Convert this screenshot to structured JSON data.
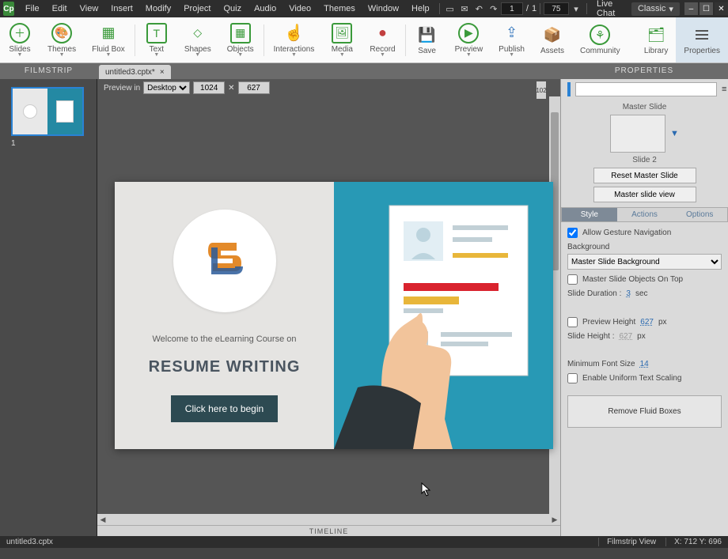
{
  "menubar": {
    "items": [
      "File",
      "Edit",
      "View",
      "Insert",
      "Modify",
      "Project",
      "Quiz",
      "Audio",
      "Video",
      "Themes",
      "Window",
      "Help"
    ],
    "page_current": "1",
    "page_total": "1",
    "zoom": "75",
    "live_chat": "Live Chat",
    "workspace": "Classic"
  },
  "ribbon": {
    "items": [
      {
        "label": "Slides",
        "icon": "＋"
      },
      {
        "label": "Themes",
        "icon": "🎨"
      },
      {
        "label": "Fluid Box",
        "icon": "▦"
      },
      {
        "label": "Text",
        "icon": "T"
      },
      {
        "label": "Shapes",
        "icon": "◇"
      },
      {
        "label": "Objects",
        "icon": "▦"
      },
      {
        "label": "Interactions",
        "icon": "☝"
      },
      {
        "label": "Media",
        "icon": "🖼"
      },
      {
        "label": "Record",
        "icon": "●"
      },
      {
        "label": "Save",
        "icon": "💾"
      },
      {
        "label": "Preview",
        "icon": "▶"
      },
      {
        "label": "Publish",
        "icon": "⇪"
      },
      {
        "label": "Assets",
        "icon": "📦"
      },
      {
        "label": "Community",
        "icon": "⚘"
      },
      {
        "label": "Library",
        "icon": "🗂"
      },
      {
        "label": "Properties",
        "icon": "≡"
      }
    ]
  },
  "tabrow": {
    "filmstrip_label": "FILMSTRIP",
    "file_tab": "untitled3.cptx*",
    "properties_label": "PROPERTIES"
  },
  "canvas": {
    "preview_in_label": "Preview in",
    "preview_device": "Desktop",
    "width": "1024",
    "height": "627",
    "link_symbol": "✕",
    "ruler_val": "102",
    "timeline_label": "TIMELINE"
  },
  "filmstrip": {
    "slide_number": "1"
  },
  "slide": {
    "welcome": "Welcome to the eLearning Course on",
    "title": "RESUME WRITING",
    "button": "Click here to begin"
  },
  "props": {
    "master_slide_label": "Master Slide",
    "slide_name": "Slide 2",
    "reset_master": "Reset Master Slide",
    "master_view": "Master slide view",
    "tabs": [
      "Style",
      "Actions",
      "Options"
    ],
    "allow_gesture": "Allow Gesture Navigation",
    "background_label": "Background",
    "background_value": "Master Slide Background",
    "master_objects_top": "Master Slide Objects On Top",
    "slide_duration_label": "Slide Duration :",
    "slide_duration_val": "3",
    "slide_duration_unit": "sec",
    "preview_height_label": "Preview Height",
    "preview_height_val": "627",
    "px": "px",
    "slide_height_label": "Slide Height :",
    "slide_height_val": "627",
    "min_font_label": "Minimum Font Size",
    "min_font_val": "14",
    "uniform_scaling": "Enable Uniform Text Scaling",
    "remove_fluid": "Remove Fluid Boxes"
  },
  "statusbar": {
    "file": "untitled3.cptx",
    "view": "Filmstrip View",
    "coords": "X: 712 Y: 696"
  }
}
